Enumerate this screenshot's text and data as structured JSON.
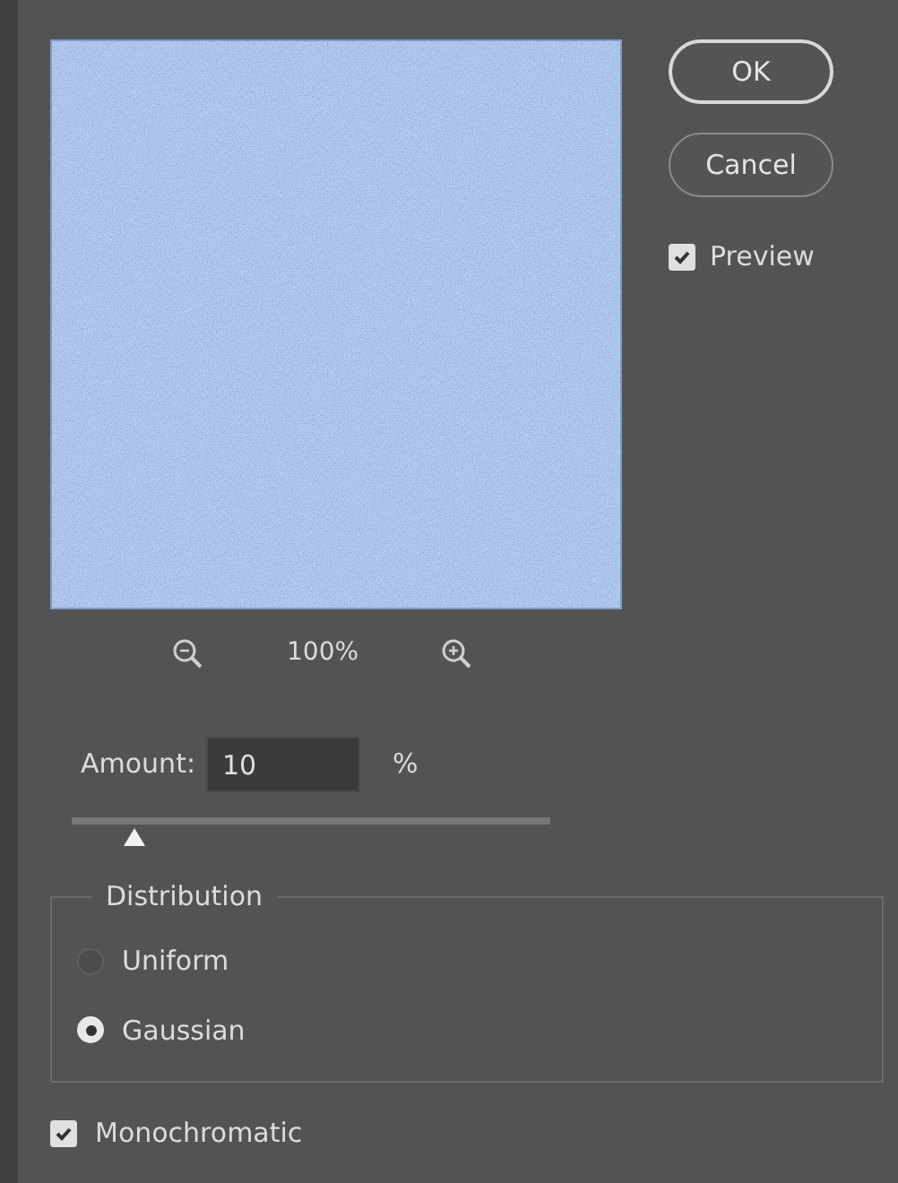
{
  "buttons": [
    {
      "label": "OK",
      "kind": "default"
    },
    {
      "label": "Cancel",
      "kind": "normal"
    }
  ],
  "preview": {
    "label": "Preview",
    "checked": true
  },
  "zoom": {
    "value": "100%"
  },
  "amount": {
    "label": "Amount:",
    "value": "10",
    "unit": "%",
    "level": 0.13
  },
  "distribution": {
    "title": "Distribution",
    "options": [
      {
        "label": "Uniform",
        "selected": false
      },
      {
        "label": "Gaussian",
        "selected": true
      }
    ]
  },
  "monochromatic": {
    "label": "Monochromatic",
    "checked": true
  }
}
